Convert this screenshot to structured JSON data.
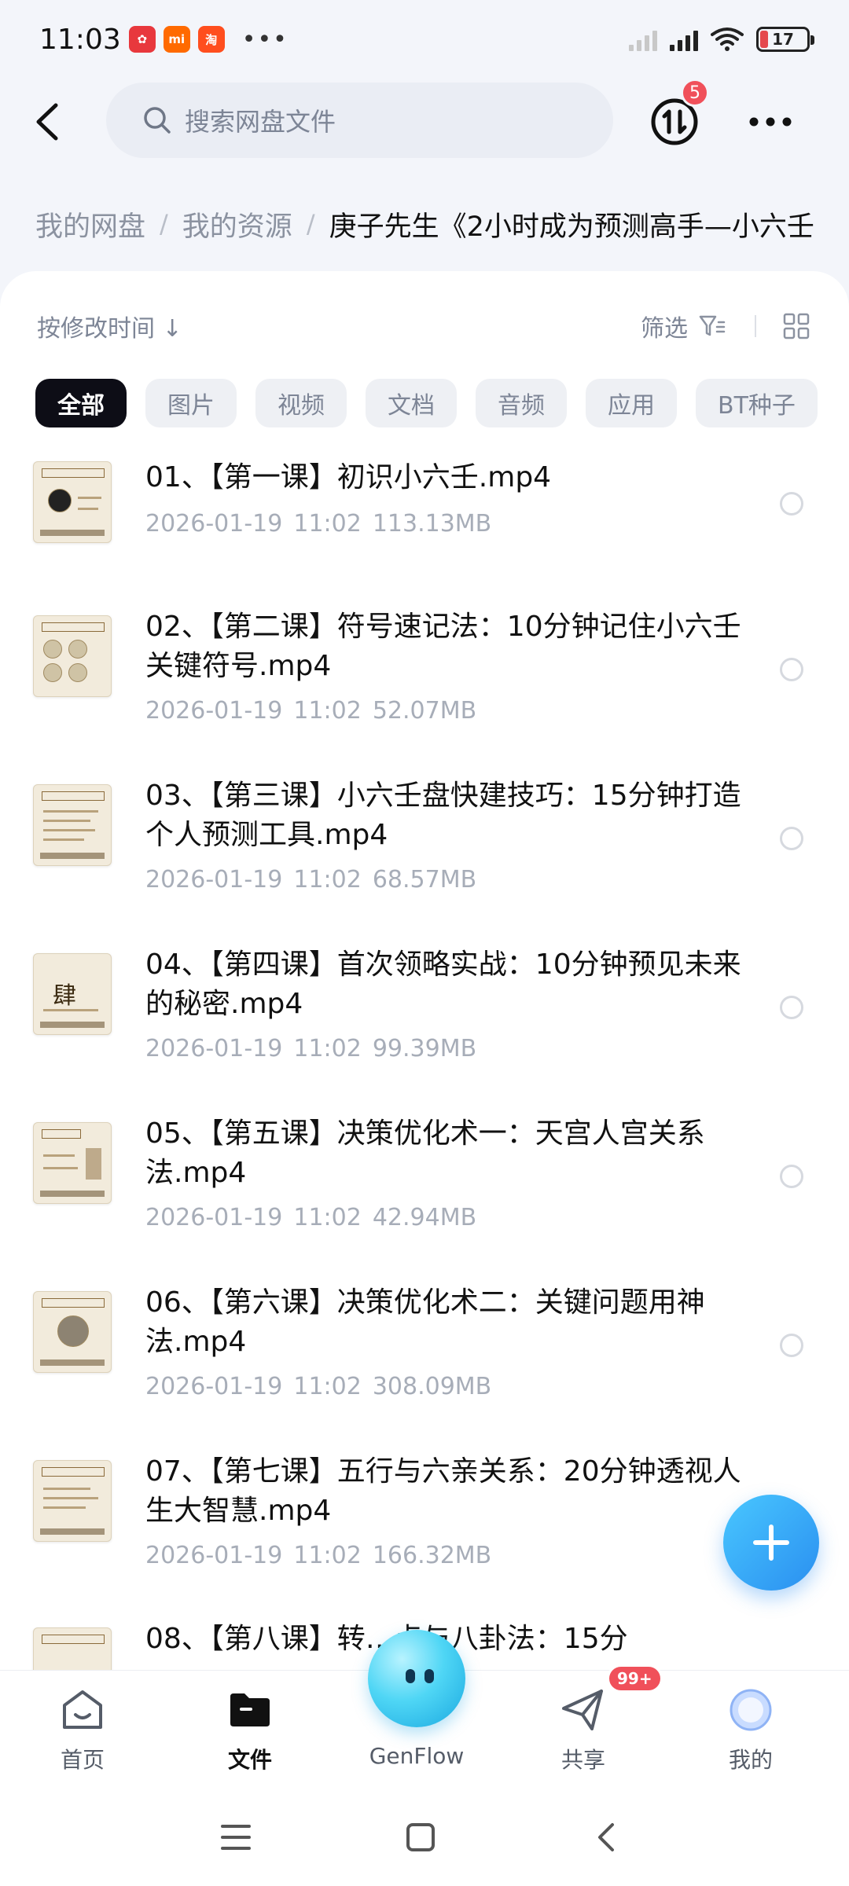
{
  "status_bar": {
    "time": "11:03",
    "app_icons": [
      "taobao-red-icon",
      "mi-icon",
      "taobao-icon"
    ],
    "more_indicator": "•••",
    "battery": "17",
    "battery_level_percent": 17
  },
  "top_bar": {
    "search_placeholder": "搜索网盘文件",
    "sync_badge": "5"
  },
  "breadcrumb": {
    "items": [
      "我的网盘",
      "我的资源"
    ],
    "current": "庚子先生《2小时成为预测高手—小六壬"
  },
  "toolbar": {
    "sort_label": "按修改时间 ↓",
    "filter_label": "筛选"
  },
  "filter_chips": [
    "全部",
    "图片",
    "视频",
    "文档",
    "音频",
    "应用",
    "BT种子"
  ],
  "files": [
    {
      "name": "01、【第一课】初识小六壬.mp4",
      "date": "2026-01-19",
      "time": "11:02",
      "size": "113.13MB",
      "thumb_glyph": ""
    },
    {
      "name": "02、【第二课】符号速记法：10分钟记住小六壬关键符号.mp4",
      "date": "2026-01-19",
      "time": "11:02",
      "size": "52.07MB",
      "thumb_glyph": ""
    },
    {
      "name": "03、【第三课】小六壬盘快建技巧：15分钟打造个人预测工具.mp4",
      "date": "2026-01-19",
      "time": "11:02",
      "size": "68.57MB",
      "thumb_glyph": ""
    },
    {
      "name": "04、【第四课】首次领略实战：10分钟预见未来的秘密.mp4",
      "date": "2026-01-19",
      "time": "11:02",
      "size": "99.39MB",
      "thumb_glyph": "肆"
    },
    {
      "name": "05、【第五课】决策优化术一：天宫人宫关系法.mp4",
      "date": "2026-01-19",
      "time": "11:02",
      "size": "42.94MB",
      "thumb_glyph": ""
    },
    {
      "name": "06、【第六课】决策优化术二：关键问题用神法.mp4",
      "date": "2026-01-19",
      "time": "11:02",
      "size": "308.09MB",
      "thumb_glyph": ""
    },
    {
      "name": "07、【第七课】五行与六亲关系：20分钟透视人生大智慧.mp4",
      "date": "2026-01-19",
      "time": "11:02",
      "size": "166.32MB",
      "thumb_glyph": ""
    },
    {
      "name": "08、【第八课】转…点与八卦法：15分",
      "date": "",
      "time": "",
      "size": "",
      "thumb_glyph": ""
    }
  ],
  "bottom_nav": [
    {
      "label": "首页",
      "icon": "home-icon"
    },
    {
      "label": "文件",
      "icon": "folder-icon"
    },
    {
      "label": "GenFlow",
      "icon": "genflow-icon"
    },
    {
      "label": "共享",
      "icon": "share-icon",
      "badge": "99+"
    },
    {
      "label": "我的",
      "icon": "profile-icon"
    }
  ],
  "colors": {
    "accent": "#2a8ff0",
    "badge": "#f0505a",
    "chip_active_bg": "#0d0d16"
  }
}
